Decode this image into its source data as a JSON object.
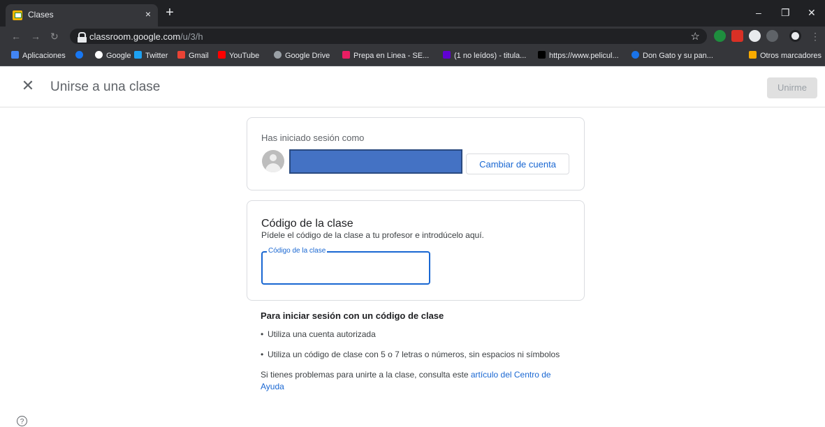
{
  "browser": {
    "tab_title": "Clases",
    "new_tab": "+",
    "tab_close": "×",
    "url_host": "classroom.google.com",
    "url_path": "/u/3/h",
    "window_controls": {
      "minimize": "–",
      "restore": "❐",
      "close": "✕"
    }
  },
  "bookmarks": [
    {
      "label": "Aplicaciones",
      "color": "#4285f4"
    },
    {
      "label": "",
      "color": "#1877f2"
    },
    {
      "label": "Google",
      "color": "#ffffff"
    },
    {
      "label": "Twitter",
      "color": "#1da1f2"
    },
    {
      "label": "Gmail",
      "color": "#ea4335"
    },
    {
      "label": "YouTube",
      "color": "#ff0000"
    },
    {
      "label": "Google Drive",
      "color": "#9aa0a6"
    },
    {
      "label": "Prepa en Linea - SE...",
      "color": "#e91e63"
    },
    {
      "label": "(1 no leídos) - titula...",
      "color": "#6001d2"
    },
    {
      "label": "https://www.pelicul...",
      "color": "#000000"
    },
    {
      "label": "Don Gato y su pan...",
      "color": "#1a73e8"
    },
    {
      "label": "Otros marcadores",
      "color": "#f9ab00"
    }
  ],
  "header": {
    "title": "Unirse a una clase",
    "close_icon": "✕",
    "join_label": "Unirme"
  },
  "account": {
    "signed_in_label": "Has iniciado sesión como",
    "switch_label": "Cambiar de cuenta"
  },
  "class_code": {
    "title": "Código de la clase",
    "description": "Pídele el código de la clase a tu profesor e introdúcelo aquí.",
    "field_label": "Código de la clase",
    "field_value": ""
  },
  "info": {
    "title": "Para iniciar sesión con un código de clase",
    "bullets": [
      "Utiliza una cuenta autorizada",
      "Utiliza un código de clase con 5 o 7 letras o números, sin espacios ni símbolos"
    ],
    "help_text": "Si tienes problemas para unirte a la clase, consulta este ",
    "help_link": "artículo del Centro de Ayuda"
  },
  "help_icon": "?"
}
